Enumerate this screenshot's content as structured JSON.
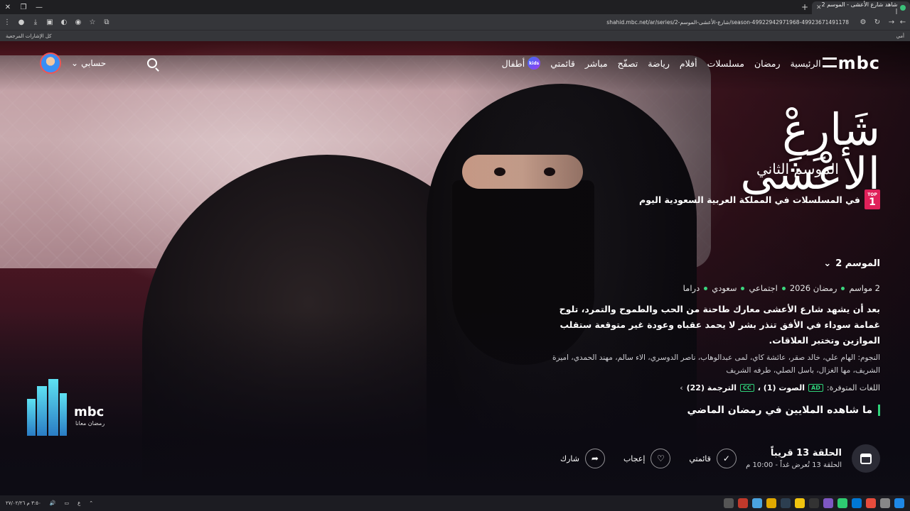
{
  "browser": {
    "tab_title": "شاهد شارع الأعشى - الموسم 2 |",
    "url": "shahid.mbc.net/ar/series/شارع-الأعشى-الموسم-2/season-49922942971968-49923671491178",
    "bookmarks_label": "كل الإشارات المرجعية",
    "bookmarks_right": "أمي"
  },
  "nav": {
    "logo": "mbc",
    "items": [
      "الرئيسية",
      "رمضان",
      "مسلسلات",
      "أفلام",
      "رياضة",
      "تصفّح",
      "مباشر",
      "قائمتي"
    ],
    "kids_label": "أطفال",
    "kids_badge": "kids",
    "account_label": "حسابي"
  },
  "show": {
    "title": "شَارِعْ الأَعْشَى",
    "season_subtitle": "الموسم الثاني",
    "top_badge_top": "TOP",
    "top_badge_num": "1",
    "top_text": "في المسلسلات في المملكة العربية السعودية اليوم",
    "season_selector": "الموسم 2",
    "meta": [
      "2 مواسم",
      "رمضان 2026",
      "اجتماعي",
      "سعودي",
      "دراما"
    ],
    "description": "بعد أن يشهد شارع الأعشى معارك طاحنة من الحب والطموح والتمرد، تلوح غمامة سوداء في الأفق تنذر بشر لا يحمد عقباه وعودة غير متوقعة ستقلب الموازين وتختبر العلاقات.",
    "cast": "النجوم: الهام علي، خالد صقر، عائشة كاي، لمى عبدالوهاب، ناصر الدوسري، الاء سالم، مهند الحمدي، اميرة الشريف، مها الغزال، باسل الصلي، طرفه الشريف",
    "languages_label": "اللغات المتوفرة:",
    "audio_tag": "AD",
    "audio_label": "الصوت (1) ،",
    "subs_tag": "CC",
    "subs_label": "الترجمة (22)",
    "millions_label": "ما شاهده الملايين في رمضان الماضي"
  },
  "episode": {
    "title": "الحلقة 13 قريباً",
    "subtitle": "الحلقة 13 تُعرض غداً - 10:00 م"
  },
  "actions": {
    "mylist": "قائمتي",
    "like": "إعجاب",
    "share": "شارك"
  },
  "ramadan_logo": {
    "brand": "mbc",
    "tagline": "رمضان معانا"
  },
  "taskbar": {
    "time": "٣:٥٠ م",
    "date": "٢٧/٠٢/٢٦",
    "lang": "ع"
  },
  "colors": {
    "accent_green": "#2fd37a",
    "top_badge": "#e0215a"
  }
}
